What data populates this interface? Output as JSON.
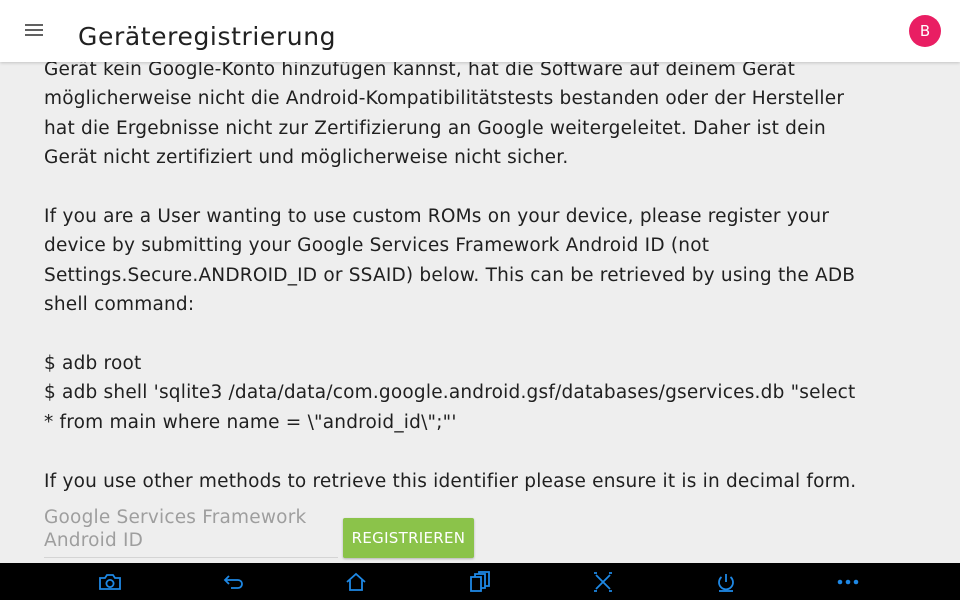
{
  "header": {
    "title": "Geräteregistrierung",
    "menu_icon": "hamburger-menu-icon",
    "avatar_letter": "B",
    "avatar_color": "#e91e63"
  },
  "main": {
    "paragraphs": [
      [
        "Gerät kein Google-Konto hinzufügen kannst, hat die Software auf deinem Gerät",
        "möglicherweise nicht die Android-Kompatibilitätstests bestanden oder der Hersteller",
        "hat die Ergebnisse nicht zur Zertifizierung an Google weitergeleitet. Daher ist dein",
        "Gerät nicht zertifiziert und möglicherweise nicht sicher."
      ],
      [
        "If you are a User wanting to use custom ROMs on your device, please register your",
        "device by submitting your Google Services Framework Android ID (not",
        "Settings.Secure.ANDROID_ID or SSAID) below. This can be retrieved by using the ADB",
        "shell command:"
      ],
      [
        "$ adb root",
        "$ adb shell 'sqlite3 /data/data/com.google.android.gsf/databases/gservices.db \"select",
        "* from main where name = \\\"android_id\\\";\"'"
      ],
      [
        "If you use other methods to retrieve this identifier please ensure it is in decimal form."
      ]
    ],
    "gsf_input": {
      "value": "",
      "placeholder_line1": "Google Services Framework",
      "placeholder_line2": "Android ID"
    },
    "register_button_label": "REGISTRIEREN",
    "register_button_color": "#8bc34a",
    "background_color": "#eeeeee"
  },
  "navbar": {
    "icon_color": "#1e88e5",
    "items": [
      "camera-icon",
      "back-icon",
      "home-icon",
      "recent-apps-icon",
      "close-x-icon",
      "power-icon",
      "more-dots-icon"
    ]
  }
}
